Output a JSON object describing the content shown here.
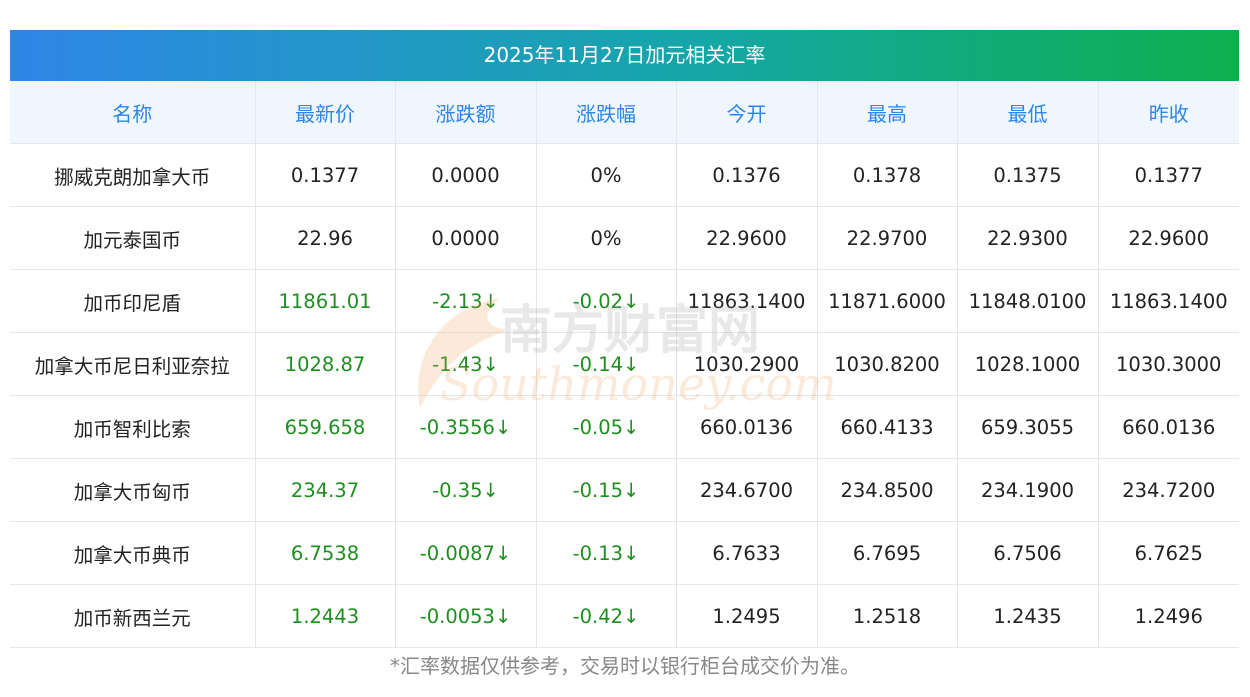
{
  "title": "2025年11月27日加元相关汇率",
  "columns": [
    "名称",
    "最新价",
    "涨跌额",
    "涨跌幅",
    "今开",
    "最高",
    "最低",
    "昨收"
  ],
  "rows": [
    {
      "name": "挪威克朗加拿大币",
      "latest": "0.1377",
      "change": "0.0000",
      "pct": "0%",
      "open": "0.1376",
      "high": "0.1378",
      "low": "0.1375",
      "prev": "0.1377",
      "trend": "flat"
    },
    {
      "name": "加元泰国币",
      "latest": "22.96",
      "change": "0.0000",
      "pct": "0%",
      "open": "22.9600",
      "high": "22.9700",
      "low": "22.9300",
      "prev": "22.9600",
      "trend": "flat"
    },
    {
      "name": "加币印尼盾",
      "latest": "11861.01",
      "change": "-2.13↓",
      "pct": "-0.02↓",
      "open": "11863.1400",
      "high": "11871.6000",
      "low": "11848.0100",
      "prev": "11863.1400",
      "trend": "down"
    },
    {
      "name": "加拿大币尼日利亚奈拉",
      "latest": "1028.87",
      "change": "-1.43↓",
      "pct": "-0.14↓",
      "open": "1030.2900",
      "high": "1030.8200",
      "low": "1028.1000",
      "prev": "1030.3000",
      "trend": "down"
    },
    {
      "name": "加币智利比索",
      "latest": "659.658",
      "change": "-0.3556↓",
      "pct": "-0.05↓",
      "open": "660.0136",
      "high": "660.4133",
      "low": "659.3055",
      "prev": "660.0136",
      "trend": "down"
    },
    {
      "name": "加拿大币匈币",
      "latest": "234.37",
      "change": "-0.35↓",
      "pct": "-0.15↓",
      "open": "234.6700",
      "high": "234.8500",
      "low": "234.1900",
      "prev": "234.7200",
      "trend": "down"
    },
    {
      "name": "加拿大币典币",
      "latest": "6.7538",
      "change": "-0.0087↓",
      "pct": "-0.13↓",
      "open": "6.7633",
      "high": "6.7695",
      "low": "6.7506",
      "prev": "6.7625",
      "trend": "down"
    },
    {
      "name": "加币新西兰元",
      "latest": "1.2443",
      "change": "-0.0053↓",
      "pct": "-0.42↓",
      "open": "1.2495",
      "high": "1.2518",
      "low": "1.2435",
      "prev": "1.2496",
      "trend": "down"
    }
  ],
  "footnote": "*汇率数据仅供参考，交易时以银行柜台成交价为准。",
  "watermark": {
    "cn": "南方财富网",
    "en": "Southmoney.com"
  },
  "colors": {
    "header_text": "#2f86e8",
    "header_bg": "#eff6fd",
    "down_text": "#1e8f1e",
    "gradient_start": "#2f86e8",
    "gradient_end": "#0cb04e"
  }
}
